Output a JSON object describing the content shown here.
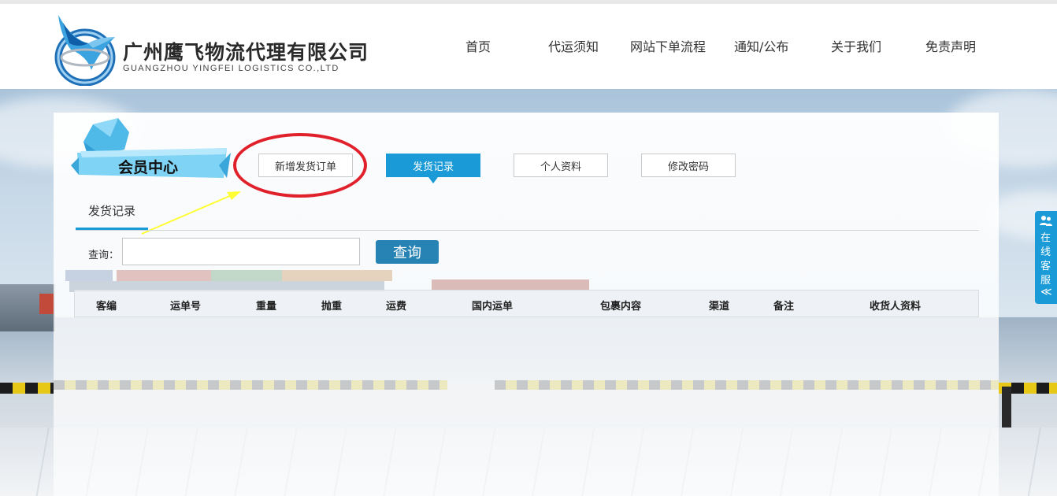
{
  "header": {
    "company_cn": "广州鹰飞物流代理有限公司",
    "company_en": "GUANGZHOU YINGFEI LOGISTICS CO.,LTD",
    "nav": [
      {
        "label": "首页"
      },
      {
        "label": "代运须知"
      },
      {
        "label": "网站下单流程"
      },
      {
        "label": "通知/公布"
      },
      {
        "label": "关于我们"
      },
      {
        "label": "免责声明"
      }
    ]
  },
  "member_center": {
    "title": "会员中心",
    "tabs": [
      {
        "label": "新增发货订单",
        "active": false
      },
      {
        "label": "发货记录",
        "active": true
      },
      {
        "label": "个人资料",
        "active": false
      },
      {
        "label": "修改密码",
        "active": false
      }
    ]
  },
  "subtab": {
    "label": "发货记录"
  },
  "search": {
    "label": "查询：",
    "value": "",
    "placeholder": "",
    "button": "查询"
  },
  "table": {
    "columns": [
      "客编",
      "运单号",
      "重量",
      "抛重",
      "运费",
      "国内运单",
      "包裹内容",
      "渠道",
      "备注",
      "收货人资料"
    ],
    "rows": []
  },
  "online_service": {
    "label": "在线客服",
    "toggle": "≪"
  },
  "colors": {
    "accent": "#1a9ad6",
    "search_button": "#2883b5",
    "annotation": "#e0202a",
    "arrow": "#ffff33"
  }
}
